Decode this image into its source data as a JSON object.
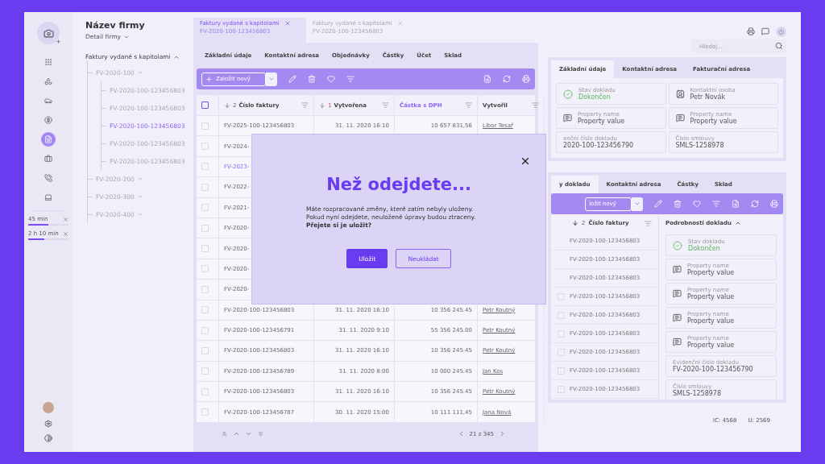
{
  "company": {
    "name": "Název firmy",
    "subtitle": "Detail firmy"
  },
  "rail": {
    "items": [
      {
        "kind": "apps",
        "selected": false
      },
      {
        "kind": "shapes",
        "selected": false
      },
      {
        "kind": "car",
        "selected": false
      },
      {
        "kind": "money",
        "selected": false
      },
      {
        "kind": "document",
        "selected": true
      },
      {
        "kind": "case",
        "selected": false
      },
      {
        "kind": "phone",
        "selected": false
      },
      {
        "kind": "laptop",
        "selected": false
      }
    ],
    "timers": [
      {
        "label": "45 min",
        "level": 0.5
      },
      {
        "label": "2 h 10 min",
        "level": 0.4
      }
    ]
  },
  "tree": {
    "label": "Faktury vydané s kapitolami",
    "expanded": true,
    "children": [
      {
        "label": "FV-2020-100",
        "expanded": true,
        "children": [
          {
            "label": "FV-2020-100-123456803",
            "selected": false
          },
          {
            "label": "FV-2020-100-123456803",
            "selected": false
          },
          {
            "label": "FV-2020-100-123456803",
            "selected": true
          },
          {
            "label": "FV-2020-100-123456803",
            "selected": false
          },
          {
            "label": "FV-2020-100-123456803",
            "selected": false
          }
        ]
      },
      {
        "label": "FV-2020-200",
        "expanded": false
      },
      {
        "label": "FV-2020-300",
        "expanded": false
      },
      {
        "label": "FV-2020-400",
        "expanded": false
      }
    ]
  },
  "doc_tabs": [
    {
      "title": "Faktury vydané s kapitolami",
      "subtitle": "FV-2020-100-123456803",
      "selected": true
    },
    {
      "title": "Faktury vydané s kapitolami",
      "subtitle": "FV-2020-100-123456803",
      "selected": false
    }
  ],
  "section_tabs": [
    "Základní údaje",
    "Kontaktní adresa",
    "Objednávky",
    "Částky",
    "Účet",
    "Sklad"
  ],
  "toolbar": {
    "new_button": "Založit nový"
  },
  "table": {
    "select_all_checked": false,
    "columns": [
      {
        "label": "Číslo faktury",
        "sort_rank": "2",
        "highlighted": false
      },
      {
        "label": "Vytvořena",
        "sort_rank": "1",
        "highlighted": false
      },
      {
        "label": "Částka s DPH",
        "highlighted": true
      },
      {
        "label": "Vytvořil",
        "highlighted": false
      }
    ],
    "rows": [
      {
        "number": "FV-2025-100-123456803",
        "created": "31. 11. 2020  16:10",
        "amount": "10 657 831,56",
        "author": "Libor Tesař",
        "selected": false,
        "checked": false
      },
      {
        "number": "FV-2024-",
        "selected": false,
        "checked": false
      },
      {
        "number": "FV-2023-",
        "selected": true,
        "checked": false
      },
      {
        "number": "FV-2022-",
        "selected": false,
        "checked": false
      },
      {
        "number": "FV-2021-",
        "selected": false,
        "checked": false
      },
      {
        "number": "FV-2020-",
        "selected": false,
        "checked": false
      },
      {
        "number": "FV-2020-",
        "selected": false,
        "checked": false
      },
      {
        "number": "FV-2020-",
        "selected": false,
        "checked": false
      },
      {
        "number": "FV-2020-",
        "selected": false,
        "checked": false
      },
      {
        "number": "FV-2020-100-123456803",
        "created": "31. 11. 2020  16:10",
        "amount": "10 356 245.45",
        "author": "Petr Koutný",
        "selected": false,
        "checked": false
      },
      {
        "number": "FV-2020-100-123456791",
        "created": "31. 11. 2020  9:10",
        "amount": "55 356 245.00",
        "author": "Petr Koutný",
        "selected": false,
        "checked": false
      },
      {
        "number": "FV-2020-100-123456803",
        "created": "31. 11. 2020  16:10",
        "amount": "10 356 245.45",
        "author": "Petr Koutný",
        "selected": false,
        "checked": false
      },
      {
        "number": "FV-2020-100-123456789",
        "created": "31. 11. 2020  8:00",
        "amount": "10 000 245.45",
        "author": "Jan Kos",
        "selected": false,
        "checked": false
      },
      {
        "number": "FV-2020-100-123456803",
        "created": "31. 11. 2020  16:10",
        "amount": "10 356 245.45",
        "author": "Petr Koutný",
        "selected": false,
        "checked": false
      },
      {
        "number": "FV-2020-100-123456787",
        "created": "30. 11. 2020  15:00",
        "amount": "10 111 111,45",
        "author": "Jana Nová",
        "selected": false,
        "checked": false
      }
    ]
  },
  "pagination": "21 z 345",
  "search": {
    "placeholder": "Hledej..."
  },
  "detail_card": {
    "tabs": [
      {
        "label": "Základní údaje",
        "selected": true
      },
      {
        "label": "Kontaktní adresa",
        "selected": false
      },
      {
        "label": "Fakturační adresa",
        "selected": false
      }
    ],
    "fields": [
      {
        "kind": "status",
        "label": "Stav dokladu",
        "value": "Dokončen"
      },
      {
        "kind": "contact",
        "label": "Kontaktní osoba",
        "value": "Petr Novák"
      },
      {
        "kind": "note",
        "label": "Property name",
        "value": "Property value"
      },
      {
        "kind": "note",
        "label": "Property name",
        "value": "Property value"
      },
      {
        "kind": "plain",
        "label": "enční číslo dokladu",
        "value": "2020-100-123456790"
      },
      {
        "kind": "plain",
        "label": "Číslo smlouvy",
        "value": "SMLS-1258978"
      }
    ]
  },
  "items_card": {
    "tabs": [
      {
        "label": "y dokladu",
        "selected": true
      },
      {
        "label": "Kontaktní adresa",
        "selected": false
      },
      {
        "label": "Částky",
        "selected": false
      },
      {
        "label": "Sklad",
        "selected": false
      }
    ],
    "new_button": "ložit nový",
    "list_header": {
      "label": "Číslo faktury",
      "sort_rank": "2"
    },
    "detail_header": {
      "label": "Podrobnosti dokladu",
      "expanded": true
    },
    "rows": [
      {
        "number": "FV-2020-100-123456803"
      },
      {
        "number": "FV-2020-100-123456803"
      },
      {
        "number": "FV-2020-100-123456803"
      },
      {
        "number": "FV-2020-100-123456803",
        "checked": false
      },
      {
        "number": "FV-2020-100-123456803",
        "checked": false
      },
      {
        "number": "FV-2020-100-123456803",
        "checked": false
      },
      {
        "number": "FV-2020-100-123456803",
        "checked": false
      },
      {
        "number": "FV-2020-100-123456803",
        "checked": false
      },
      {
        "number": "FV-2020-100-123456803",
        "checked": false
      }
    ],
    "fields": [
      {
        "kind": "status",
        "label": "Stav dokladu",
        "value": "Dokončen"
      },
      {
        "kind": "note",
        "label": "Property name",
        "value": "Property value"
      },
      {
        "kind": "note",
        "label": "Property name",
        "value": "Property value"
      },
      {
        "kind": "note",
        "label": "Property name",
        "value": "Property value"
      },
      {
        "kind": "note",
        "label": "Property name",
        "value": "Property value"
      },
      {
        "kind": "plain",
        "label": "Evidenční číslo dokladu",
        "value": "FV-2020-100-123456790"
      },
      {
        "kind": "plain",
        "label": "Číslo smlouvy",
        "value": "SMLS-1258978"
      }
    ]
  },
  "status_bar": [
    "IC: 4568",
    "U: 2569"
  ],
  "dialog": {
    "title": "Než odejdete...",
    "message": "Máte rozpracované změny, které zatím nebyly uloženy.\nPokud nyní odejdete, neuložené úpravy budou ztraceny.\n**Přejete si je uložit?**",
    "buttons": [
      {
        "label": "Uložit",
        "kind": "primary"
      },
      {
        "label": "Neukládat",
        "kind": "secondary"
      }
    ]
  }
}
